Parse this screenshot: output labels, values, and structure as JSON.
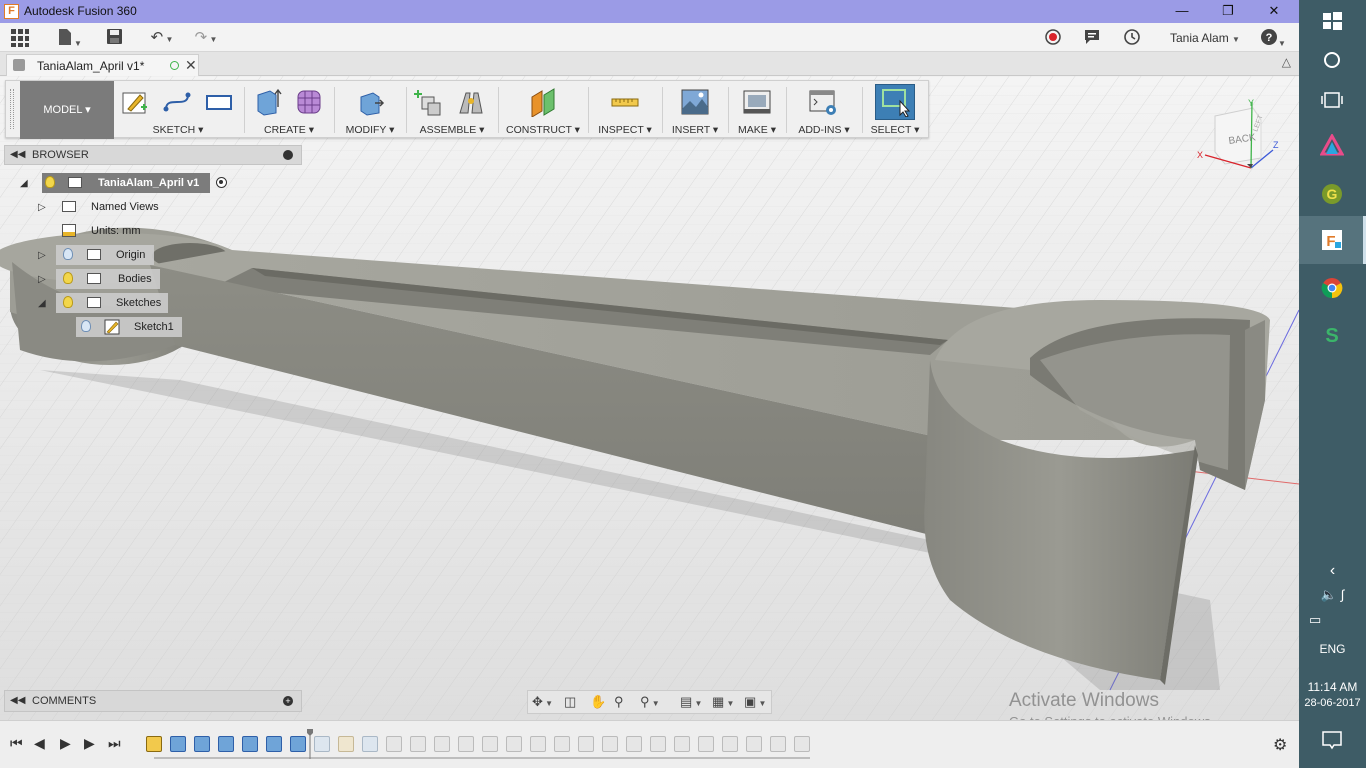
{
  "window": {
    "title": "Autodesk Fusion 360",
    "app_icon_letter": "F"
  },
  "qat": {
    "user": "Tania Alam"
  },
  "document_tab": {
    "label": "TaniaAlam_April v1*"
  },
  "ribbon": {
    "workspace": "MODEL ▾",
    "groups": [
      {
        "label": "SKETCH ▾"
      },
      {
        "label": "CREATE ▾"
      },
      {
        "label": "MODIFY ▾"
      },
      {
        "label": "ASSEMBLE ▾"
      },
      {
        "label": "CONSTRUCT ▾"
      },
      {
        "label": "INSPECT ▾"
      },
      {
        "label": "INSERT ▾"
      },
      {
        "label": "MAKE ▾"
      },
      {
        "label": "ADD-INS ▾"
      },
      {
        "label": "SELECT ▾"
      }
    ]
  },
  "browser": {
    "title": "BROWSER",
    "root": "TaniaAlam_April v1",
    "items": [
      "Named Views",
      "Units: mm",
      "Origin",
      "Bodies",
      "Sketches",
      "Sketch1"
    ]
  },
  "comments": {
    "title": "COMMENTS"
  },
  "viewcube": {
    "face": "BACK",
    "side": "LEFT",
    "axis_x": "X",
    "axis_y": "Y",
    "axis_z": "Z"
  },
  "watermark": {
    "line1": "Activate Windows",
    "line2": "Go to Settings to activate Windows."
  },
  "taskbar": {
    "language": "ENG",
    "time": "11:14 AM",
    "date": "28-06-2017"
  },
  "colors": {
    "titlebar": "#9b9be6",
    "taskbar": "#3e5c66",
    "model": "#8e8e86",
    "select_active": "#3d7fb5"
  }
}
